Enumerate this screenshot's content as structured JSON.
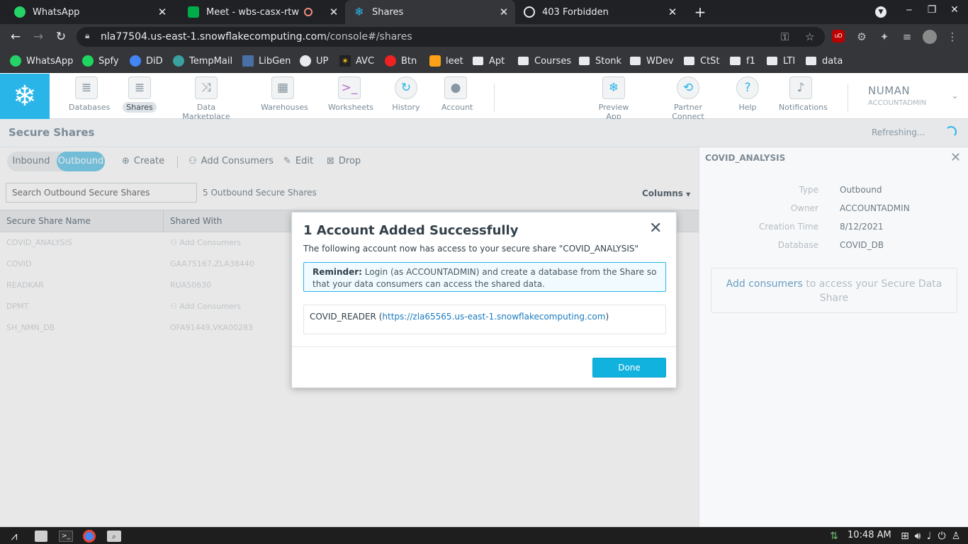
{
  "browser": {
    "tabs": [
      {
        "title": "WhatsApp",
        "icon": "whatsapp-icon",
        "color": "#25d366"
      },
      {
        "title": "Meet - wbs-casx-rtw",
        "icon": "meet-icon",
        "color": "#00ac47",
        "recording": true
      },
      {
        "title": "Shares",
        "icon": "snowflake-icon",
        "color": "#29b5e8",
        "active": true
      },
      {
        "title": "403 Forbidden",
        "icon": "globe-icon",
        "color": "#e8eaed"
      }
    ],
    "url_host": "nla77504.us-east-1.snowflakecomputing.com",
    "url_path": "/console#/shares",
    "bookmarks": [
      {
        "label": "WhatsApp",
        "icon": "whatsapp-icon",
        "color": "#25d366"
      },
      {
        "label": "Spfy",
        "icon": "spotify-icon",
        "color": "#1ed760"
      },
      {
        "label": "DiD",
        "icon": "did-icon",
        "color": "#4285f4"
      },
      {
        "label": "TempMail",
        "icon": "tempmail-icon",
        "color": "#3aa0a0"
      },
      {
        "label": "LibGen",
        "icon": "libgen-icon",
        "color": "#4a6fa5"
      },
      {
        "label": "UP",
        "icon": "globe-icon",
        "color": "#e8eaed"
      },
      {
        "label": "AVC",
        "icon": "avc-icon",
        "color": "#f5c518"
      },
      {
        "label": "Btn",
        "icon": "btn-icon",
        "color": "#e22"
      },
      {
        "label": "leet",
        "icon": "leetcode-icon",
        "color": "#ffa116"
      },
      {
        "label": "Apt",
        "icon": "folder-icon"
      },
      {
        "label": "Courses",
        "icon": "folder-icon"
      },
      {
        "label": "Stonk",
        "icon": "folder-icon"
      },
      {
        "label": "WDev",
        "icon": "folder-icon"
      },
      {
        "label": "CtSt",
        "icon": "folder-icon"
      },
      {
        "label": "f1",
        "icon": "folder-icon"
      },
      {
        "label": "LTI",
        "icon": "folder-icon"
      },
      {
        "label": "data",
        "icon": "folder-icon"
      }
    ]
  },
  "nav": {
    "items": [
      {
        "label": "Databases",
        "icon": "database-icon"
      },
      {
        "label": "Shares",
        "icon": "shares-icon",
        "selected": true
      },
      {
        "label": "Data Marketplace",
        "icon": "marketplace-icon"
      },
      {
        "label": "Warehouses",
        "icon": "warehouse-icon"
      },
      {
        "label": "Worksheets",
        "icon": "worksheet-icon"
      },
      {
        "label": "History",
        "icon": "history-icon"
      },
      {
        "label": "Account",
        "icon": "account-icon"
      }
    ],
    "right_items": [
      {
        "label": "Preview App",
        "icon": "snowflake-icon"
      },
      {
        "label": "Partner Connect",
        "icon": "partner-connect-icon"
      },
      {
        "label": "Help",
        "icon": "help-icon"
      },
      {
        "label": "Notifications",
        "icon": "bell-icon"
      }
    ],
    "user_name": "NUMAN",
    "user_role": "ACCOUNTADMIN"
  },
  "page": {
    "title": "Secure Shares",
    "status": "Refreshing..."
  },
  "toolbar": {
    "inbound": "Inbound",
    "outbound": "Outbound",
    "create": "Create",
    "add_consumers": "Add Consumers",
    "edit": "Edit",
    "drop": "Drop"
  },
  "list": {
    "search_placeholder": "Search Outbound Secure Shares",
    "count": "5 Outbound Secure Shares",
    "columns_button": "Columns",
    "headers": [
      "Secure Share Name",
      "Shared With"
    ],
    "rows": [
      {
        "name": "COVID_ANALYSIS",
        "shared_with": "Add Consumers"
      },
      {
        "name": "COVID",
        "shared_with": "GAA75167,ZLA38440"
      },
      {
        "name": "READKAR",
        "shared_with": "RUA50630"
      },
      {
        "name": "DPMT",
        "shared_with": "Add Consumers"
      },
      {
        "name": "SH_NMN_DB",
        "shared_with": "OFA91449,VKA00283"
      }
    ]
  },
  "detail": {
    "title": "COVID_ANALYSIS",
    "fields": [
      {
        "key": "Type",
        "value": "Outbound"
      },
      {
        "key": "Owner",
        "value": "ACCOUNTADMIN"
      },
      {
        "key": "Creation Time",
        "value": "8/12/2021"
      },
      {
        "key": "Database",
        "value": "COVID_DB"
      }
    ],
    "consumers_link": "Add consumers",
    "consumers_text": " to access your Secure Data Share"
  },
  "modal": {
    "title": "1 Account Added Successfully",
    "description": "The following account now has access to your secure share \"COVID_ANALYSIS\"",
    "reminder_label": "Reminder:",
    "reminder_text": " Login (as ACCOUNTADMIN) and create a database from the Share so that your data consumers can access the shared data.",
    "account_name": "COVID_READER",
    "account_url": "https://zla65565.us-east-1.snowflakecomputing.com",
    "done": "Done"
  },
  "taskbar": {
    "clock": "10:48 AM"
  }
}
